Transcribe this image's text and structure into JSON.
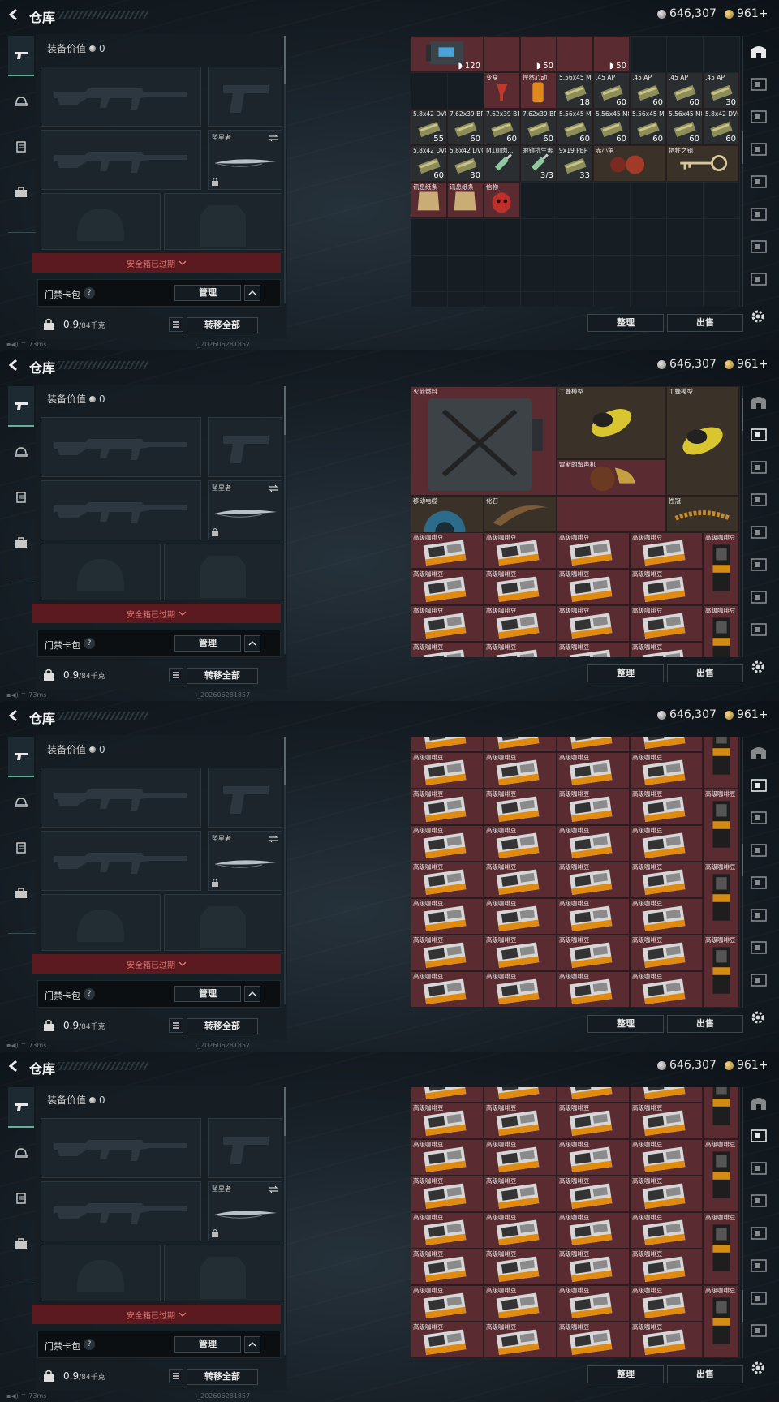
{
  "header": {
    "title": "仓库",
    "silver": "646,307",
    "gold": "961+"
  },
  "equip": {
    "value_label": "装备价值",
    "value": "0",
    "knife_name": "坠星者",
    "secure_box": "安全箱已过期",
    "keybag": "门禁卡包",
    "help": "?",
    "manage": "管理",
    "weight": "0.9",
    "weight_max": "/84千克",
    "transfer_all": "转移全部"
  },
  "status": {
    "ping": "73ms",
    "build": ")_202606281857"
  },
  "actions": {
    "sort": "整理",
    "sell": "出售"
  },
  "icons": {
    "rail": [
      "gun-icon",
      "helmet-icon",
      "vest-icon",
      "backpack-icon"
    ],
    "side": [
      "stash-home-icon",
      "cat1-icon",
      "cat2-icon",
      "cat3-icon",
      "cat4-icon",
      "cat5-icon",
      "cat6-icon",
      "cat7-icon"
    ]
  },
  "screens": [
    {
      "scroll_pos": 0.4,
      "active_side": 0,
      "items": [
        {
          "c": 0,
          "r": 0,
          "w": 2,
          "h": 1,
          "name": "",
          "count": "120",
          "shield": true,
          "col": "red",
          "icon": "case"
        },
        {
          "c": 2,
          "r": 0,
          "w": 1,
          "h": 1,
          "name": "",
          "count": "",
          "col": "red",
          "icon": "none"
        },
        {
          "c": 3,
          "r": 0,
          "w": 1,
          "h": 1,
          "name": "",
          "count": "50",
          "shield": true,
          "col": "red",
          "icon": "none"
        },
        {
          "c": 4,
          "r": 0,
          "w": 1,
          "h": 1,
          "name": "",
          "count": "",
          "col": "red",
          "icon": "none"
        },
        {
          "c": 5,
          "r": 0,
          "w": 1,
          "h": 1,
          "name": "",
          "count": "50",
          "shield": true,
          "col": "red",
          "icon": "none"
        },
        {
          "c": 2,
          "r": 1,
          "w": 1,
          "h": 1,
          "name": "变身",
          "count": "",
          "col": "red",
          "icon": "drink"
        },
        {
          "c": 3,
          "r": 1,
          "w": 1,
          "h": 1,
          "name": "怦然心动",
          "count": "",
          "col": "red",
          "icon": "can"
        },
        {
          "c": 4,
          "r": 1,
          "w": 1,
          "h": 1,
          "name": "5.56x45 M...",
          "count": "18",
          "col": "dark",
          "icon": "ammo"
        },
        {
          "c": 5,
          "r": 1,
          "w": 1,
          "h": 1,
          "name": ".45 AP",
          "count": "60",
          "col": "dark",
          "icon": "ammo"
        },
        {
          "c": 6,
          "r": 1,
          "w": 1,
          "h": 1,
          "name": ".45 AP",
          "count": "60",
          "col": "dark",
          "icon": "ammo"
        },
        {
          "c": 7,
          "r": 1,
          "w": 1,
          "h": 1,
          "name": ".45 AP",
          "count": "60",
          "col": "dark",
          "icon": "ammo"
        },
        {
          "c": 8,
          "r": 1,
          "w": 1,
          "h": 1,
          "name": ".45 AP",
          "count": "30",
          "col": "dark",
          "icon": "ammo"
        },
        {
          "c": 0,
          "r": 2,
          "w": 1,
          "h": 1,
          "name": "5.8x42 DVC12",
          "count": "55",
          "col": "dark",
          "icon": "ammo"
        },
        {
          "c": 1,
          "r": 2,
          "w": 1,
          "h": 1,
          "name": "7.62x39 BP",
          "count": "60",
          "col": "dark",
          "icon": "ammo"
        },
        {
          "c": 2,
          "r": 2,
          "w": 1,
          "h": 1,
          "name": "7.62x39 BP",
          "count": "60",
          "col": "dark",
          "icon": "ammo"
        },
        {
          "c": 3,
          "r": 2,
          "w": 1,
          "h": 1,
          "name": "7.62x39 BP",
          "count": "60",
          "col": "dark",
          "icon": "ammo"
        },
        {
          "c": 4,
          "r": 2,
          "w": 1,
          "h": 1,
          "name": "5.56x45 M855A1",
          "count": "60",
          "col": "dark",
          "icon": "ammo"
        },
        {
          "c": 5,
          "r": 2,
          "w": 1,
          "h": 1,
          "name": "5.56x45 M855A1",
          "count": "60",
          "col": "dark",
          "icon": "ammo"
        },
        {
          "c": 6,
          "r": 2,
          "w": 1,
          "h": 1,
          "name": "5.56x45 M855A1",
          "count": "60",
          "col": "dark",
          "icon": "ammo"
        },
        {
          "c": 7,
          "r": 2,
          "w": 1,
          "h": 1,
          "name": "5.56x45 M855A1",
          "count": "60",
          "col": "dark",
          "icon": "ammo"
        },
        {
          "c": 8,
          "r": 2,
          "w": 1,
          "h": 1,
          "name": "5.8x42 DVC12",
          "count": "60",
          "col": "dark",
          "icon": "ammo"
        },
        {
          "c": 0,
          "r": 3,
          "w": 1,
          "h": 1,
          "name": "5.8x42 DVC12",
          "count": "60",
          "col": "dark",
          "icon": "ammo"
        },
        {
          "c": 1,
          "r": 3,
          "w": 1,
          "h": 1,
          "name": "5.8x42 DVC12",
          "count": "30",
          "col": "dark",
          "icon": "ammo"
        },
        {
          "c": 2,
          "r": 3,
          "w": 1,
          "h": 1,
          "name": "M1肌肉...",
          "count": "",
          "col": "dark",
          "icon": "syringe"
        },
        {
          "c": 3,
          "r": 3,
          "w": 1,
          "h": 1,
          "name": "眼镜抗生素",
          "count": "3/3",
          "col": "dark",
          "icon": "syringe"
        },
        {
          "c": 4,
          "r": 3,
          "w": 1,
          "h": 1,
          "name": "9x19 PBP",
          "count": "33",
          "col": "dark",
          "icon": "ammo"
        },
        {
          "c": 5,
          "r": 3,
          "w": 2,
          "h": 1,
          "name": "赤小龟",
          "count": "",
          "col": "brown",
          "icon": "turtle"
        },
        {
          "c": 7,
          "r": 3,
          "w": 2,
          "h": 1,
          "name": "牺牲之钥",
          "count": "",
          "col": "brown",
          "icon": "key"
        },
        {
          "c": 0,
          "r": 4,
          "w": 1,
          "h": 1,
          "name": "讯息纸条",
          "count": "",
          "col": "red",
          "icon": "note"
        },
        {
          "c": 1,
          "r": 4,
          "w": 1,
          "h": 1,
          "name": "讯息纸条",
          "count": "",
          "col": "red",
          "icon": "note"
        },
        {
          "c": 2,
          "r": 4,
          "w": 1,
          "h": 1,
          "name": "信物",
          "count": "",
          "col": "red",
          "icon": "mask"
        }
      ]
    },
    {
      "scroll_pos": 0.05,
      "active_side": 1,
      "items": [
        {
          "c": 0,
          "r": 0,
          "w": 4,
          "h": 3,
          "name": "火箭燃料",
          "count": "",
          "col": "red",
          "icon": "jerrycan"
        },
        {
          "c": 4,
          "r": 0,
          "w": 3,
          "h": 2,
          "name": "工蜂模型",
          "count": "",
          "col": "brown",
          "icon": "bee"
        },
        {
          "c": 7,
          "r": 0,
          "w": 2,
          "h": 3,
          "name": "工蜂模型",
          "count": "",
          "col": "brown",
          "icon": "bee"
        },
        {
          "c": 4,
          "r": 2,
          "w": 3,
          "h": 1,
          "name": "雷斯的留声机",
          "count": "",
          "col": "red",
          "icon": "gramophone"
        },
        {
          "c": 0,
          "r": 3,
          "w": 2,
          "h": 2,
          "name": "移动电缆",
          "count": "",
          "col": "brown",
          "icon": "cable"
        },
        {
          "c": 2,
          "r": 3,
          "w": 2,
          "h": 1,
          "name": "化石",
          "count": "",
          "col": "brown",
          "icon": "fossil"
        },
        {
          "c": 4,
          "r": 3,
          "w": 3,
          "h": 1,
          "name": "",
          "count": "",
          "col": "red",
          "icon": "none"
        },
        {
          "c": 7,
          "r": 3,
          "w": 2,
          "h": 1,
          "name": "性冠",
          "count": "",
          "col": "brown",
          "icon": "crown"
        }
      ],
      "coffee_from_row": 4
    },
    {
      "scroll_pos": 0.45,
      "active_side": 1,
      "coffee_from_row": 0,
      "items": []
    },
    {
      "scroll_pos": 0.85,
      "active_side": 1,
      "coffee_from_row": 0,
      "items": []
    }
  ],
  "coffee_name": "高级咖啡豆",
  "coffee_tall_name": "高级咖啡豆"
}
